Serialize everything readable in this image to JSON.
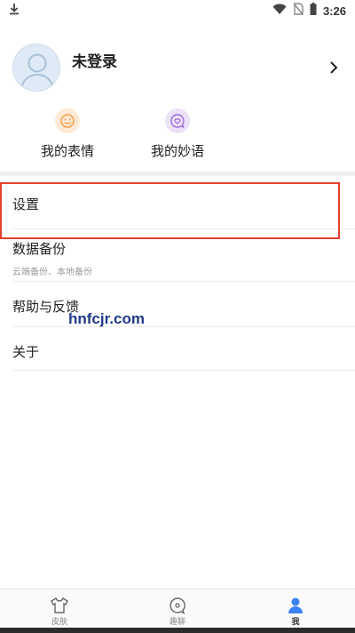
{
  "status_bar": {
    "time": "3:26",
    "icons": [
      "download-icon",
      "wifi-icon",
      "no-sim-icon",
      "battery-icon"
    ]
  },
  "profile": {
    "name": "未登录"
  },
  "quick_actions": [
    {
      "label": "我的表情",
      "icon": "smiley-icon",
      "color": "#f5a04a"
    },
    {
      "label": "我的妙语",
      "icon": "heart-chat-icon",
      "color": "#9b6bd6"
    }
  ],
  "menu": [
    {
      "label": "设置",
      "sub": ""
    },
    {
      "label": "数据备份",
      "sub": "云端备份、本地备份"
    },
    {
      "label": "帮助与反馈",
      "sub": ""
    },
    {
      "label": "关于",
      "sub": ""
    }
  ],
  "watermark": "hnfcjr.com",
  "tabs": [
    {
      "label": "皮肤",
      "icon": "tshirt-icon",
      "active": false
    },
    {
      "label": "趣聊",
      "icon": "chat-bubble-icon",
      "active": false
    },
    {
      "label": "我",
      "icon": "person-icon",
      "active": true
    }
  ],
  "colors": {
    "highlight": "#e8402e",
    "active_tab": "#3b82f6",
    "watermark": "#1f3a8a"
  }
}
